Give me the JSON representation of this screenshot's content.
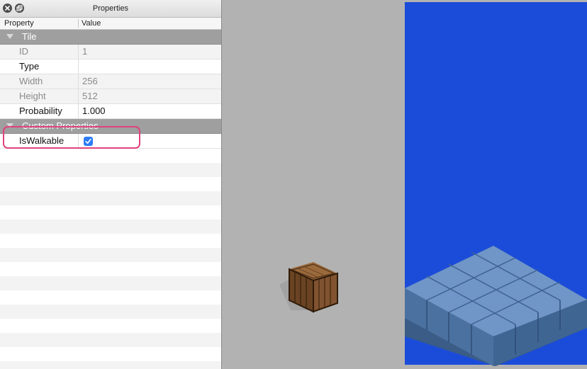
{
  "window": {
    "title": "Properties",
    "buttons": [
      "close-icon",
      "float-icon"
    ]
  },
  "table": {
    "header_property": "Property",
    "header_value": "Value"
  },
  "groups": {
    "tile": "Tile",
    "custom": "Custom Properties"
  },
  "rows": {
    "id": {
      "key": "ID",
      "value": "1"
    },
    "type": {
      "key": "Type",
      "value": ""
    },
    "width": {
      "key": "Width",
      "value": "256"
    },
    "height": {
      "key": "Height",
      "value": "512"
    },
    "probability": {
      "key": "Probability",
      "value": "1.000"
    },
    "iswalkable": {
      "key": "IsWalkable",
      "checked": true
    }
  },
  "colors": {
    "group_bg": "#9f9f9f",
    "tile_bg": "#1b4cd9",
    "canvas_bg": "#b2b2b2",
    "highlight": "#e0427c",
    "checkbox": "#2d7cf6"
  }
}
